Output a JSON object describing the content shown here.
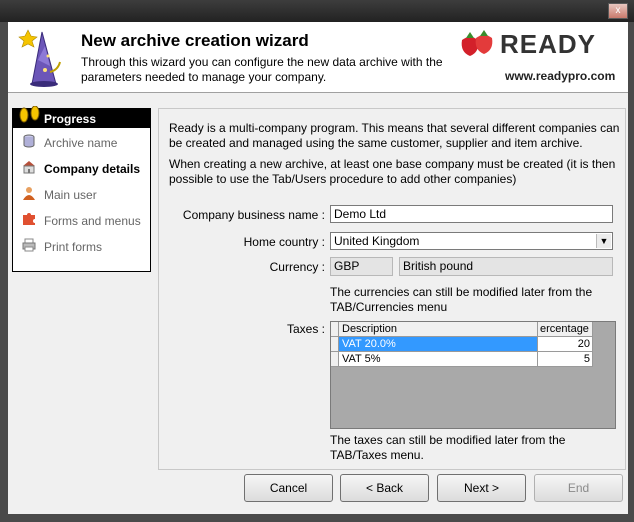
{
  "window": {
    "close_glyph": "x"
  },
  "header": {
    "title": "New archive creation wizard",
    "description": "Through this wizard you can configure the new data archive with the parameters needed to manage your company.",
    "logo_text": "READY",
    "url": "www.readypro.com"
  },
  "progress": {
    "title": "Progress",
    "steps": [
      {
        "label": "Archive name",
        "icon": "database-icon",
        "active": false
      },
      {
        "label": "Company details",
        "icon": "company-icon",
        "active": true
      },
      {
        "label": "Main user",
        "icon": "user-icon",
        "active": false
      },
      {
        "label": "Forms and menus",
        "icon": "puzzle-icon",
        "active": false
      },
      {
        "label": "Print forms",
        "icon": "printer-icon",
        "active": false
      }
    ]
  },
  "content": {
    "intro": "Ready is a multi-company program. This means that several different companies can be created and managed using the same customer, supplier and item archive.",
    "note": "When creating a new archive, at least one base company must be created (it is then possible to use the Tab/Users procedure to add other companies)",
    "company_label": "Company business name :",
    "company_value": "Demo Ltd",
    "country_label": "Home country :",
    "country_value": "United Kingdom",
    "currency_label": "Currency :",
    "currency_code": "GBP",
    "currency_name": "British pound",
    "currency_note": "The currencies can still be modified later from the TAB/Currencies menu",
    "taxes_label": "Taxes :",
    "taxes_note": "The taxes can still be modified later from the TAB/Taxes menu.",
    "taxes_grid": {
      "col_description": "Description",
      "col_percentage": "ercentage",
      "rows": [
        {
          "description": "VAT 20.0%",
          "percentage": "20",
          "selected": true
        },
        {
          "description": "VAT 5%",
          "percentage": "5",
          "selected": false
        }
      ]
    }
  },
  "buttons": {
    "cancel": "Cancel",
    "back": "< Back",
    "next": "Next >",
    "end": "End"
  }
}
